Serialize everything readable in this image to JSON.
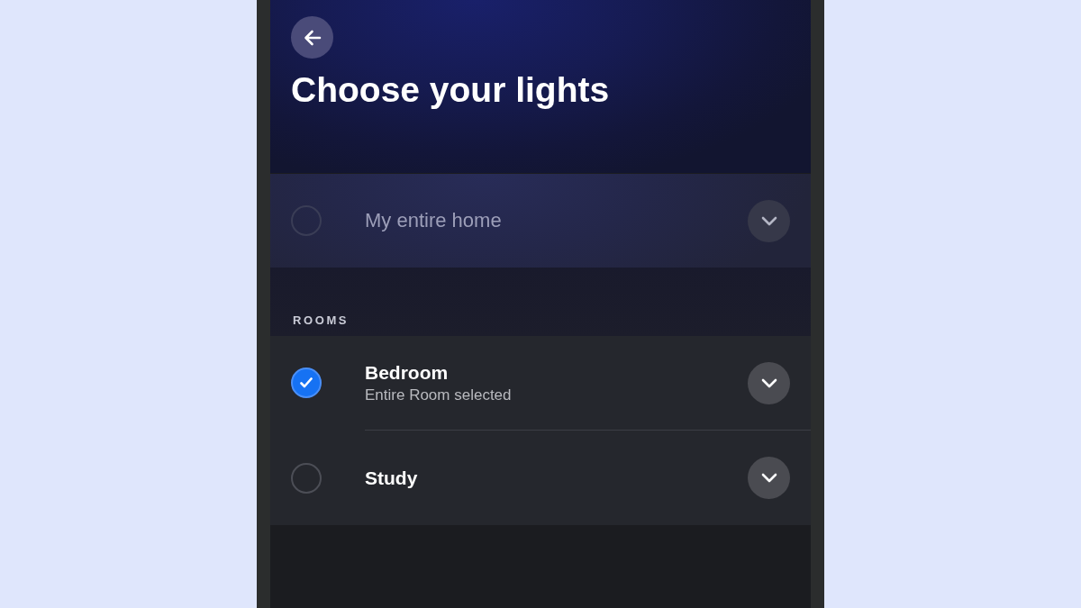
{
  "header": {
    "title": "Choose your lights"
  },
  "home_option": {
    "label": "My entire home",
    "checked": false,
    "disabled": true,
    "expanded": false
  },
  "rooms_section": {
    "heading": "ROOMS",
    "rooms": [
      {
        "name": "Bedroom",
        "detail": "Entire Room selected",
        "checked": true,
        "expanded": false
      },
      {
        "name": "Study",
        "checked": false,
        "expanded": false
      }
    ]
  }
}
